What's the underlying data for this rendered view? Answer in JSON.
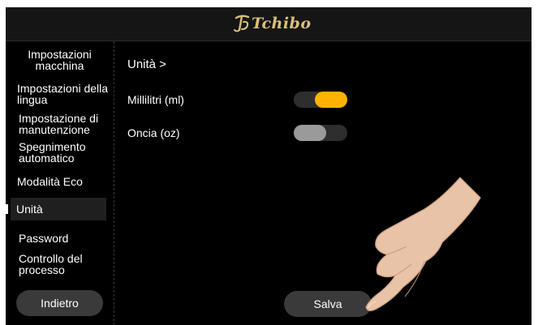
{
  "brand": {
    "name": "Tchibo",
    "logo_color": "#d9c07a"
  },
  "sidebar": {
    "header": "Impostazioni macchina",
    "items": [
      {
        "label": "Impostazioni della lingua"
      },
      {
        "label": "Impostazione di manutenzione"
      },
      {
        "label": "Spegnimento automatico"
      },
      {
        "label": "Modalità Eco"
      },
      {
        "label": "Unità",
        "active": true
      },
      {
        "label": "Password"
      },
      {
        "label": "Controllo del processo"
      }
    ],
    "back_label": "Indietro"
  },
  "content": {
    "title": "Unità >",
    "options": [
      {
        "label": "Millilitri (ml)",
        "enabled": true
      },
      {
        "label": "Oncia (oz)",
        "enabled": false
      }
    ],
    "save_label": "Salva"
  },
  "colors": {
    "accent": "#ffb300",
    "toggle_off_knob": "#9a9a9a",
    "background": "#000000",
    "button": "#3a3a3a"
  }
}
